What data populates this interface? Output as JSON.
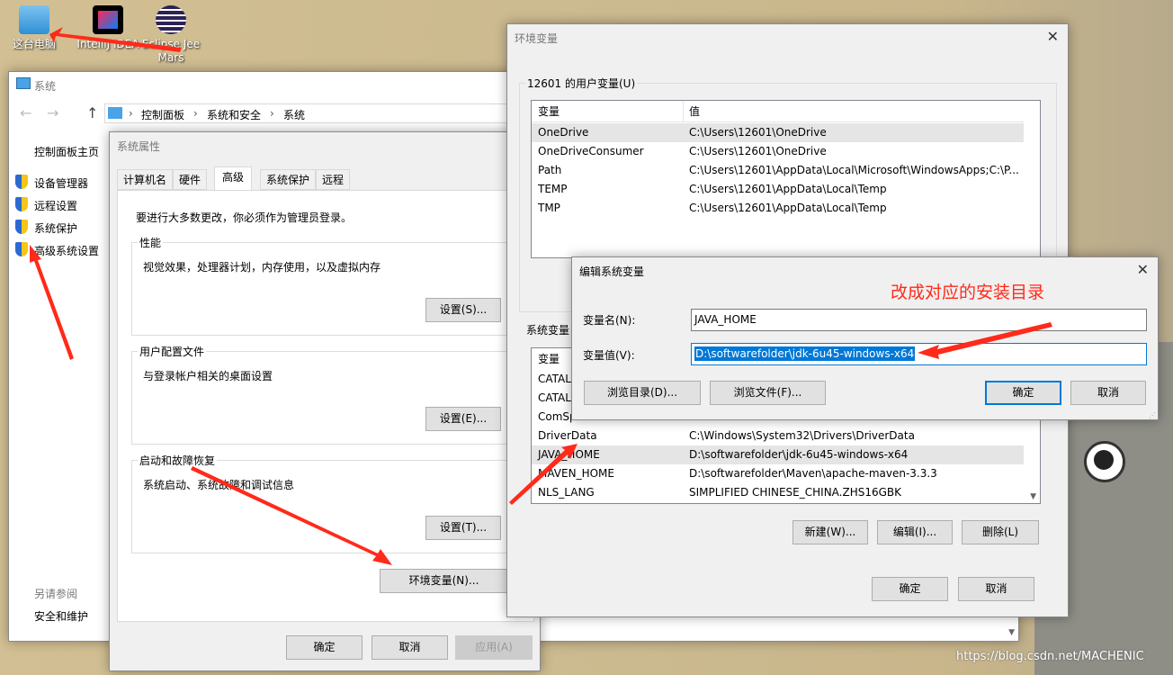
{
  "desktop": {
    "icons": [
      {
        "label": "这台电脑"
      },
      {
        "label": "IntelliJ IDEA"
      },
      {
        "label": "Eclipse Jee Mars"
      }
    ],
    "watermark": "https://blog.csdn.net/MACHENIC"
  },
  "system_window": {
    "title": "系统",
    "breadcrumb": [
      "控制面板",
      "系统和安全",
      "系统"
    ],
    "sidebar": {
      "home": "控制面板主页",
      "items": [
        "设备管理器",
        "远程设置",
        "系统保护",
        "高级系统设置"
      ],
      "see_also": "另请参阅",
      "see_also_items": [
        "安全和维护"
      ]
    }
  },
  "sys_props": {
    "title": "系统属性",
    "tabs": [
      "计算机名",
      "硬件",
      "高级",
      "系统保护",
      "远程"
    ],
    "active_tab": "高级",
    "admin_note": "要进行大多数更改，你必须作为管理员登录。",
    "groups": [
      {
        "label": "性能",
        "desc": "视觉效果，处理器计划，内存使用，以及虚拟内存",
        "button": "设置(S)..."
      },
      {
        "label": "用户配置文件",
        "desc": "与登录帐户相关的桌面设置",
        "button": "设置(E)..."
      },
      {
        "label": "启动和故障恢复",
        "desc": "系统启动、系统故障和调试信息",
        "button": "设置(T)..."
      }
    ],
    "env_button": "环境变量(N)...",
    "ok": "确定",
    "cancel": "取消",
    "apply": "应用(A)"
  },
  "env_vars": {
    "title": "环境变量",
    "user_group": "12601 的用户变量(U)",
    "col_var": "变量",
    "col_val": "值",
    "user_vars": [
      {
        "name": "OneDrive",
        "value": "C:\\Users\\12601\\OneDrive"
      },
      {
        "name": "OneDriveConsumer",
        "value": "C:\\Users\\12601\\OneDrive"
      },
      {
        "name": "Path",
        "value": "C:\\Users\\12601\\AppData\\Local\\Microsoft\\WindowsApps;C:\\P..."
      },
      {
        "name": "TEMP",
        "value": "C:\\Users\\12601\\AppData\\Local\\Temp"
      },
      {
        "name": "TMP",
        "value": "C:\\Users\\12601\\AppData\\Local\\Temp"
      }
    ],
    "system_group": "系统变量",
    "system_vars": [
      {
        "name": "CATAL",
        "value": ""
      },
      {
        "name": "CATAL",
        "value": ""
      },
      {
        "name": "ComSp",
        "value": ""
      },
      {
        "name": "DriverData",
        "value": "C:\\Windows\\System32\\Drivers\\DriverData"
      },
      {
        "name": "JAVA_HOME",
        "value": "D:\\softwarefolder\\jdk-6u45-windows-x64"
      },
      {
        "name": "MAVEN_HOME",
        "value": "D:\\softwarefolder\\Maven\\apache-maven-3.3.3"
      },
      {
        "name": "NLS_LANG",
        "value": "SIMPLIFIED CHINESE_CHINA.ZHS16GBK"
      }
    ],
    "new": "新建(W)...",
    "edit": "编辑(I)...",
    "delete": "删除(L)",
    "ok": "确定",
    "cancel": "取消"
  },
  "edit_dialog": {
    "title": "编辑系统变量",
    "name_label": "变量名(N):",
    "name_value": "JAVA_HOME",
    "value_label": "变量值(V):",
    "value_value": "D:\\softwarefolder\\jdk-6u45-windows-x64",
    "browse_dir": "浏览目录(D)...",
    "browse_file": "浏览文件(F)...",
    "ok": "确定",
    "cancel": "取消"
  },
  "annotation": {
    "text": "改成对应的安装目录",
    "color": "#ff2a1a"
  }
}
